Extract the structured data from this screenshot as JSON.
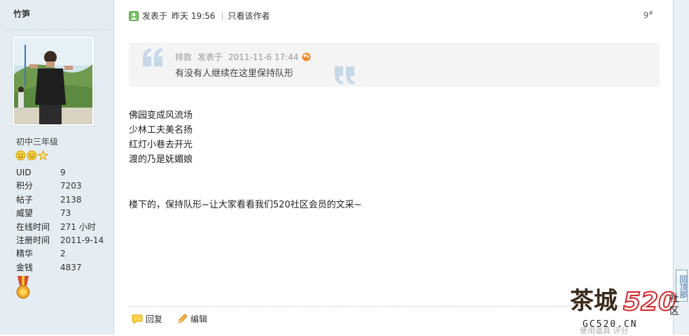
{
  "user": {
    "name": "竹笋",
    "group": "初中三年级",
    "stats": [
      {
        "label": "UID",
        "value": "9"
      },
      {
        "label": "积分",
        "value": "7203"
      },
      {
        "label": "帖子",
        "value": "2138"
      },
      {
        "label": "威望",
        "value": "73"
      },
      {
        "label": "在线时间",
        "value": "271 小时"
      },
      {
        "label": "注册时间",
        "value": "2011-9-14"
      },
      {
        "label": "精华",
        "value": "2"
      },
      {
        "label": "金钱",
        "value": "4837"
      }
    ]
  },
  "post": {
    "posted_label": "发表于",
    "posted_time": "昨天 19:56",
    "only_author": "只看该作者",
    "floor": "9",
    "floor_mark": "#",
    "quote": {
      "author": "排款",
      "posted_label": "发表于",
      "time": "2011-11-6 17:44",
      "text": "有没有人继续在这里保持队形"
    },
    "lines": [
      "佛园变成风流场",
      "少林工夫美名扬",
      "红灯小巷去开光",
      "渡的乃是妩媚娘"
    ],
    "tail": "楼下的，保持队形~让大家看看我们520社区会员的文采~"
  },
  "actions": {
    "reply": "回复",
    "edit": "编辑"
  },
  "faded_text": "使用道具     评分",
  "back_to_top": "回顶部",
  "watermark": {
    "brand": "茶城",
    "number": "520",
    "suffix": "社区",
    "domain": "GC520.CN"
  },
  "colors": {
    "sidebar": "#e5edf2",
    "border": "#c2d5e3",
    "quote_mark": "#c6d8e8",
    "watermark_red": "#d5252a"
  }
}
